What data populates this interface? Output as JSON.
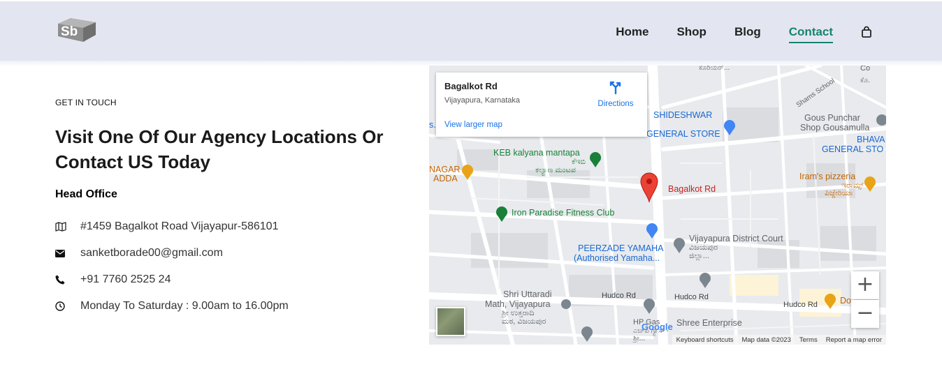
{
  "header": {
    "logo_text": "Sb",
    "nav": [
      "Home",
      "Shop",
      "Blog",
      "Contact"
    ],
    "active_nav": "Contact",
    "accent_color": "#16836f",
    "background_color": "#e3e6f1"
  },
  "contact": {
    "eyebrow": "GET IN TOUCH",
    "heading": "Visit One Of Our Agency Locations Or Contact US Today",
    "subheading": "Head Office",
    "address": "#1459 Bagalkot Road Vijayapur-586101",
    "email": "sanketborade00@gmail.com",
    "phone": "+91 7760 2525 24",
    "hours": "Monday To Saturday : 9.00am to 16.00pm"
  },
  "map": {
    "place_name": "Bagalkot Rd",
    "place_address": "Vijayapura, Karnataka",
    "directions": "Directions",
    "view_larger": "View larger map",
    "marker_label": "Bagalkot Rd",
    "labels": {
      "keb": "KEB kalyana mantapa",
      "keb_kn1": "ಕೆಇಬಿ",
      "keb_kn2": "ಕಲ್ಯಾಣ ಮಂಟಪ",
      "iron": "Iron Paradise Fitness Club",
      "shideshwar1": "SHIDESHWAR",
      "shideshwar2": "GENERAL STORE",
      "gous1": "Gous Punchar",
      "gous2": "Shop Gousamulla",
      "bhava1": "BHAVA",
      "bhava2": "GENERAL STO",
      "irams": "Iram's pizzeria",
      "irams_kn1": "ಇರಾಮ್ಸ್",
      "irams_kn2": "ಪಿಜ್ಜೇರಿಯಾ",
      "nagar": "NAGAR",
      "adda": "ADDA",
      "peerzade1": "PEERZADE YAMAHA",
      "peerzade2": "(Authorised Yamaha...",
      "court": "Vijayapura District Court",
      "court_kn1": "ವಿಜಯಪುರ",
      "court_kn2": "ಜಿಲ್ಲಾ...",
      "uttaradi1": "Shri Uttaradi",
      "uttaradi2": "Math, Vijayapura",
      "uttaradi_kn1": "ಶ್ರೀ ಉತ್ತರಾದಿ",
      "uttaradi_kn2": "ಮಠ, ವಿಜಯಪುರ",
      "hudco1": "Hudco Rd",
      "hudco2": "Hudco Rd",
      "hudco3": "Hudco Rd",
      "hp": "HP Gas",
      "hp_kn": "ಎಚ್‌ಪಿ ಗ್ಯಾಸ್ -",
      "hp_kn2": "ಶ್ರೀ...",
      "shree": "Shree Enterprise",
      "shams": "Shams School",
      "courier": "ಕೊರಿಯರ್...",
      "co1": "Co",
      "co2": "ಕೊ.",
      "dos": "Do",
      "s_label": "s."
    },
    "google_logo": "Google",
    "footer": [
      "Keyboard shortcuts",
      "Map data ©2023",
      "Terms",
      "Report a map error"
    ],
    "zoom_in": "+",
    "zoom_out": "−"
  }
}
